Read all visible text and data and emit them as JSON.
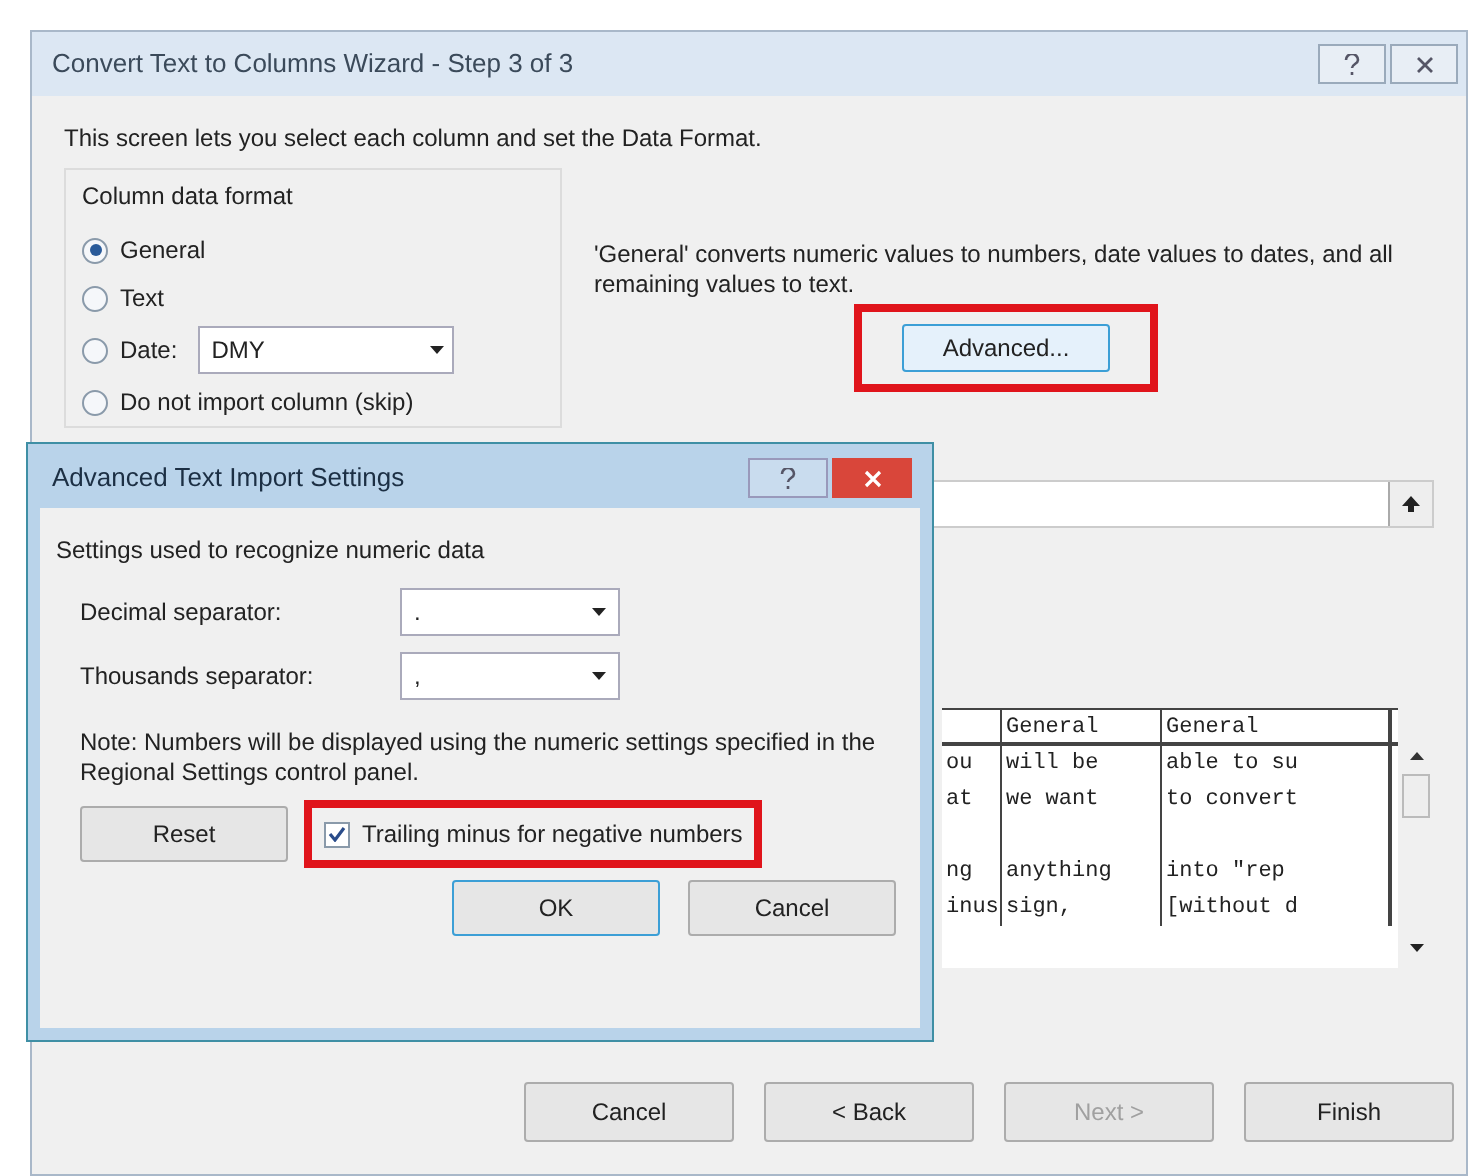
{
  "window": {
    "title": "Convert Text to Columns Wizard - Step 3 of 3"
  },
  "instruction": "This screen lets you select each column and set the Data Format.",
  "column_data_format": {
    "label": "Column data format",
    "options": [
      {
        "kind": "radio",
        "label": "General",
        "selected": true
      },
      {
        "kind": "radio",
        "label": "Text",
        "selected": false
      },
      {
        "kind": "radio_with_combo",
        "label": "Date:",
        "selected": false,
        "combo_value": "DMY"
      },
      {
        "kind": "radio",
        "label": "Do not import column (skip)",
        "selected": false
      }
    ]
  },
  "description": "'General' converts numeric values to numbers, date values to dates, and all remaining values to text.",
  "advanced_button": {
    "label": "Advanced...",
    "highlighted": true
  },
  "preview": {
    "headers": [
      "General",
      "General"
    ],
    "rows": [
      {
        "kind": "text",
        "cells": [
          "ou",
          "will be",
          "able to su"
        ]
      },
      {
        "kind": "text",
        "cells": [
          "at",
          "we want",
          "to convert"
        ]
      },
      {
        "kind": "blank"
      },
      {
        "kind": "text",
        "cells": [
          "ng",
          "anything",
          "into \"rep"
        ]
      },
      {
        "kind": "text",
        "cells": [
          "inus",
          "sign,",
          "[without d"
        ]
      }
    ]
  },
  "buttons": [
    {
      "label": "Cancel",
      "disabled": false
    },
    {
      "label": "< Back",
      "disabled": false
    },
    {
      "label": "Next >",
      "disabled": true
    },
    {
      "label": "Finish",
      "disabled": false
    }
  ],
  "advanced_dialog": {
    "title": "Advanced Text Import Settings",
    "group_label": "Settings used to recognize numeric data",
    "fields": [
      {
        "label": "Decimal separator:",
        "value": "."
      },
      {
        "label": "Thousands separator:",
        "value": ","
      }
    ],
    "note": "Note: Numbers will be displayed using the numeric settings specified in the Regional Settings control panel.",
    "reset_label": "Reset",
    "checkbox": {
      "label": "Trailing minus for negative numbers",
      "checked": true,
      "highlighted": true
    },
    "buttons": [
      {
        "label": "OK",
        "focused": true
      },
      {
        "label": "Cancel",
        "focused": false
      }
    ]
  }
}
